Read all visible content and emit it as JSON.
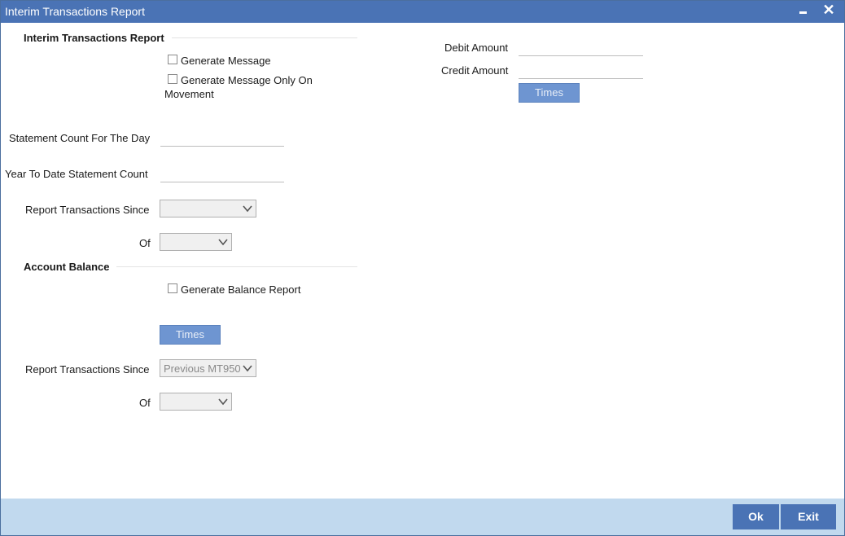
{
  "window": {
    "title": "Interim Transactions Report",
    "minimize_glyph": "",
    "close_glyph": "✕"
  },
  "interim": {
    "section_title": "Interim Transactions Report",
    "generate_message": "Generate Message",
    "generate_on_movement_line1": "Generate Message Only On",
    "generate_on_movement_line2": "Movement",
    "statement_count_label": "Statement Count For The Day",
    "ytd_count_label": "Year To Date Statement Count",
    "report_since_label": "Report Transactions Since",
    "report_since_value": "",
    "of_label": "Of",
    "of_value": ""
  },
  "amounts": {
    "debit_label": "Debit Amount",
    "credit_label": "Credit Amount",
    "times_label": "Times"
  },
  "balance": {
    "section_title": "Account Balance",
    "generate_balance": "Generate Balance Report",
    "times_label": "Times",
    "report_since_label": "Report Transactions Since",
    "report_since_value": "Previous MT950",
    "of_label": "Of",
    "of_value": ""
  },
  "footer": {
    "ok_label": "Ok",
    "exit_label": "Exit"
  },
  "colors": {
    "titlebar": "#4a73b5",
    "footer": "#c1d9ee",
    "times_button": "#6e95d1"
  }
}
